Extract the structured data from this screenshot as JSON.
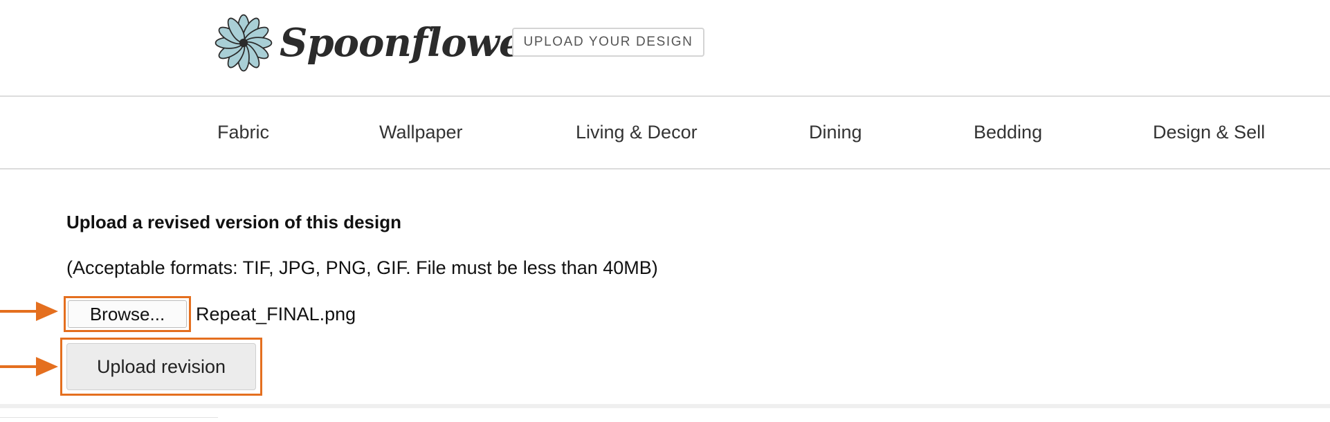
{
  "header": {
    "logo_text": "Spoonflower",
    "upload_design_label": "UPLOAD YOUR DESIGN"
  },
  "nav": {
    "items": [
      {
        "label": "Fabric"
      },
      {
        "label": "Wallpaper"
      },
      {
        "label": "Living & Decor"
      },
      {
        "label": "Dining"
      },
      {
        "label": "Bedding"
      },
      {
        "label": "Design & Sell"
      }
    ]
  },
  "content": {
    "title": "Upload a revised version of this design",
    "formats": "(Acceptable formats: TIF, JPG, PNG, GIF. File must be less than 40MB)",
    "browse_label": "Browse...",
    "file_name": "Repeat_FINAL.png",
    "upload_label": "Upload revision"
  },
  "colors": {
    "highlight": "#e46f1f",
    "logo_petal": "#a9cfd6"
  },
  "icons": {
    "logo": "spoonflower-flower-icon",
    "annotation_arrow": "arrow-right-icon"
  }
}
